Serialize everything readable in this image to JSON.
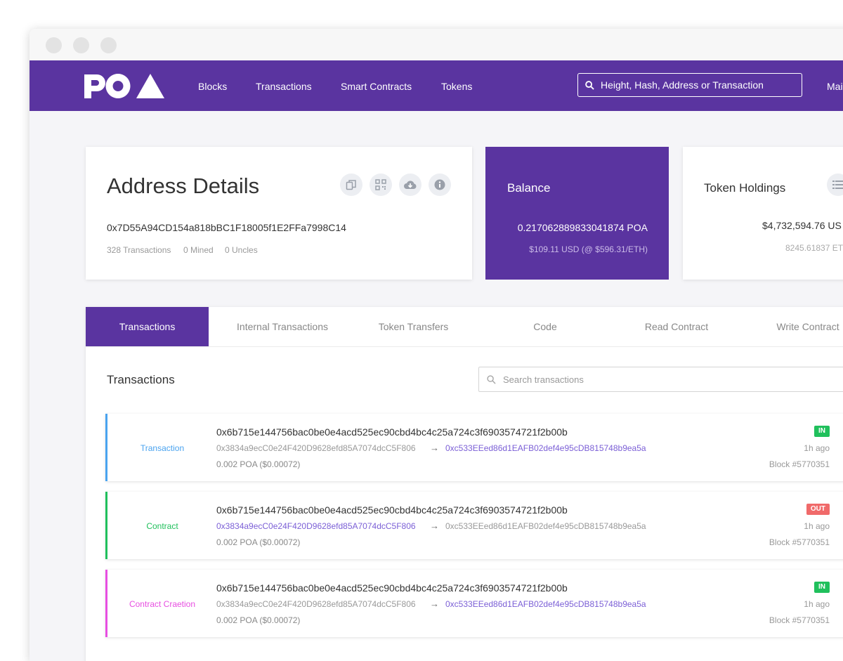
{
  "nav": {
    "logo": "POA",
    "links": [
      "Blocks",
      "Transactions",
      "Smart Contracts",
      "Tokens"
    ],
    "search_placeholder": "Height, Hash, Address or Transaction",
    "network": "Mai"
  },
  "address": {
    "title": "Address Details",
    "hash": "0x7D55A94CD154a818bBC1F18005f1E2FFa7998C14",
    "transactions": "328 Transactions",
    "mined": "0 Mined",
    "uncles": "0 Uncles",
    "icons": [
      "copy-icon",
      "qr-code-icon",
      "cloud-download-icon",
      "info-icon"
    ]
  },
  "balance": {
    "title": "Balance",
    "value": "0.217062889833041874 POA",
    "usd": "$109.11 USD (@ $596.31/ETH)"
  },
  "token_holdings": {
    "title": "Token Holdings",
    "value": "$4,732,594.76 US",
    "sub": "8245.61837 ET"
  },
  "tabs": [
    "Transactions",
    "Internal Transactions",
    "Token Transfers",
    "Code",
    "Read Contract",
    "Write Contract"
  ],
  "transactions": {
    "title": "Transactions",
    "search_placeholder": "Search transactions",
    "items": [
      {
        "type": "Transaction",
        "color": "#4aa3ef",
        "hash": "0x6b715e144756bac0be0e4acd525ec90cbd4bc4c25a724c3f6903574721f2b00b",
        "from": "0x3834a9ecC0e24F420D9628efd85A7074dcC5F806",
        "to": "0xc533EEed86d1EAFB02def4e95cDB815748b9ea5a",
        "amount": "0.002 POA ($0.00072)",
        "direction": "IN",
        "direction_color": "#20c05c",
        "time": "1h ago",
        "block": "Block #5770351",
        "highlight": "to"
      },
      {
        "type": "Contract",
        "color": "#20c05c",
        "hash": "0x6b715e144756bac0be0e4acd525ec90cbd4bc4c25a724c3f6903574721f2b00b",
        "from": "0x3834a9ecC0e24F420D9628efd85A7074dcC5F806",
        "to": "0xc533EEed86d1EAFB02def4e95cDB815748b9ea5a",
        "amount": "0.002 POA ($0.00072)",
        "direction": "OUT",
        "direction_color": "#f06a6a",
        "time": "1h ago",
        "block": "Block #5770351",
        "highlight": "from"
      },
      {
        "type": "Contract Craetion",
        "color": "#e74ee1",
        "hash": "0x6b715e144756bac0be0e4acd525ec90cbd4bc4c25a724c3f6903574721f2b00b",
        "from": "0x3834a9ecC0e24F420D9628efd85A7074dcC5F806",
        "to": "0xc533EEed86d1EAFB02def4e95cDB815748b9ea5a",
        "amount": "0.002 POA ($0.00072)",
        "direction": "IN",
        "direction_color": "#20c05c",
        "time": "1h ago",
        "block": "Block #5770351",
        "highlight": "to"
      }
    ]
  }
}
